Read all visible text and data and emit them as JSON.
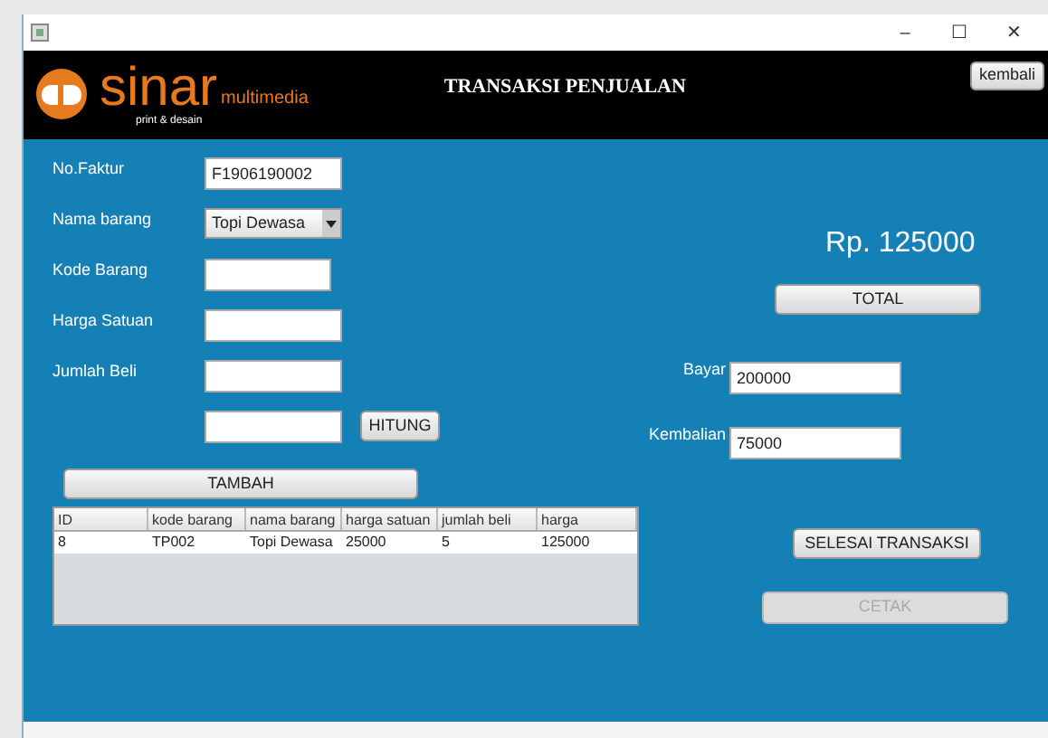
{
  "window": {
    "controls": [
      "–",
      "☐",
      "✕"
    ]
  },
  "header": {
    "logo": {
      "name": "sinar",
      "tagline": "multimedia",
      "subtitle": "print & desain"
    },
    "title": "TRANSAKSI PENJUALAN",
    "back_button": "kembali"
  },
  "form": {
    "fields": [
      {
        "kind": "text",
        "label": "No.Faktur",
        "value": "F1906190002"
      },
      {
        "kind": "select",
        "label": "Nama barang",
        "value": "Topi Dewasa"
      },
      {
        "kind": "text",
        "label": "Kode Barang"
      },
      {
        "kind": "text",
        "label": "Harga Satuan"
      },
      {
        "kind": "text",
        "label": "Jumlah Beli"
      },
      {
        "kind": "text",
        "button": "HITUNG"
      }
    ],
    "add_button": "TAMBAH"
  },
  "table": {
    "columns": [
      "ID",
      "kode barang",
      "nama barang",
      "harga satuan",
      "jumlah beli",
      "harga"
    ],
    "rows": [
      [
        "8",
        "TP002",
        "Topi Dewasa",
        "25000",
        "5",
        "125000"
      ]
    ]
  },
  "summary": {
    "total_text": "Rp. 125000",
    "total_button": "TOTAL",
    "payment": [
      {
        "label": "Bayar",
        "value": "200000"
      },
      {
        "label": "Kembalian",
        "value": "75000"
      }
    ],
    "finish_button": {
      "label": "SELESAI TRANSAKSI",
      "disabled": false
    },
    "print_button": {
      "label": "CETAK",
      "disabled": true
    }
  }
}
